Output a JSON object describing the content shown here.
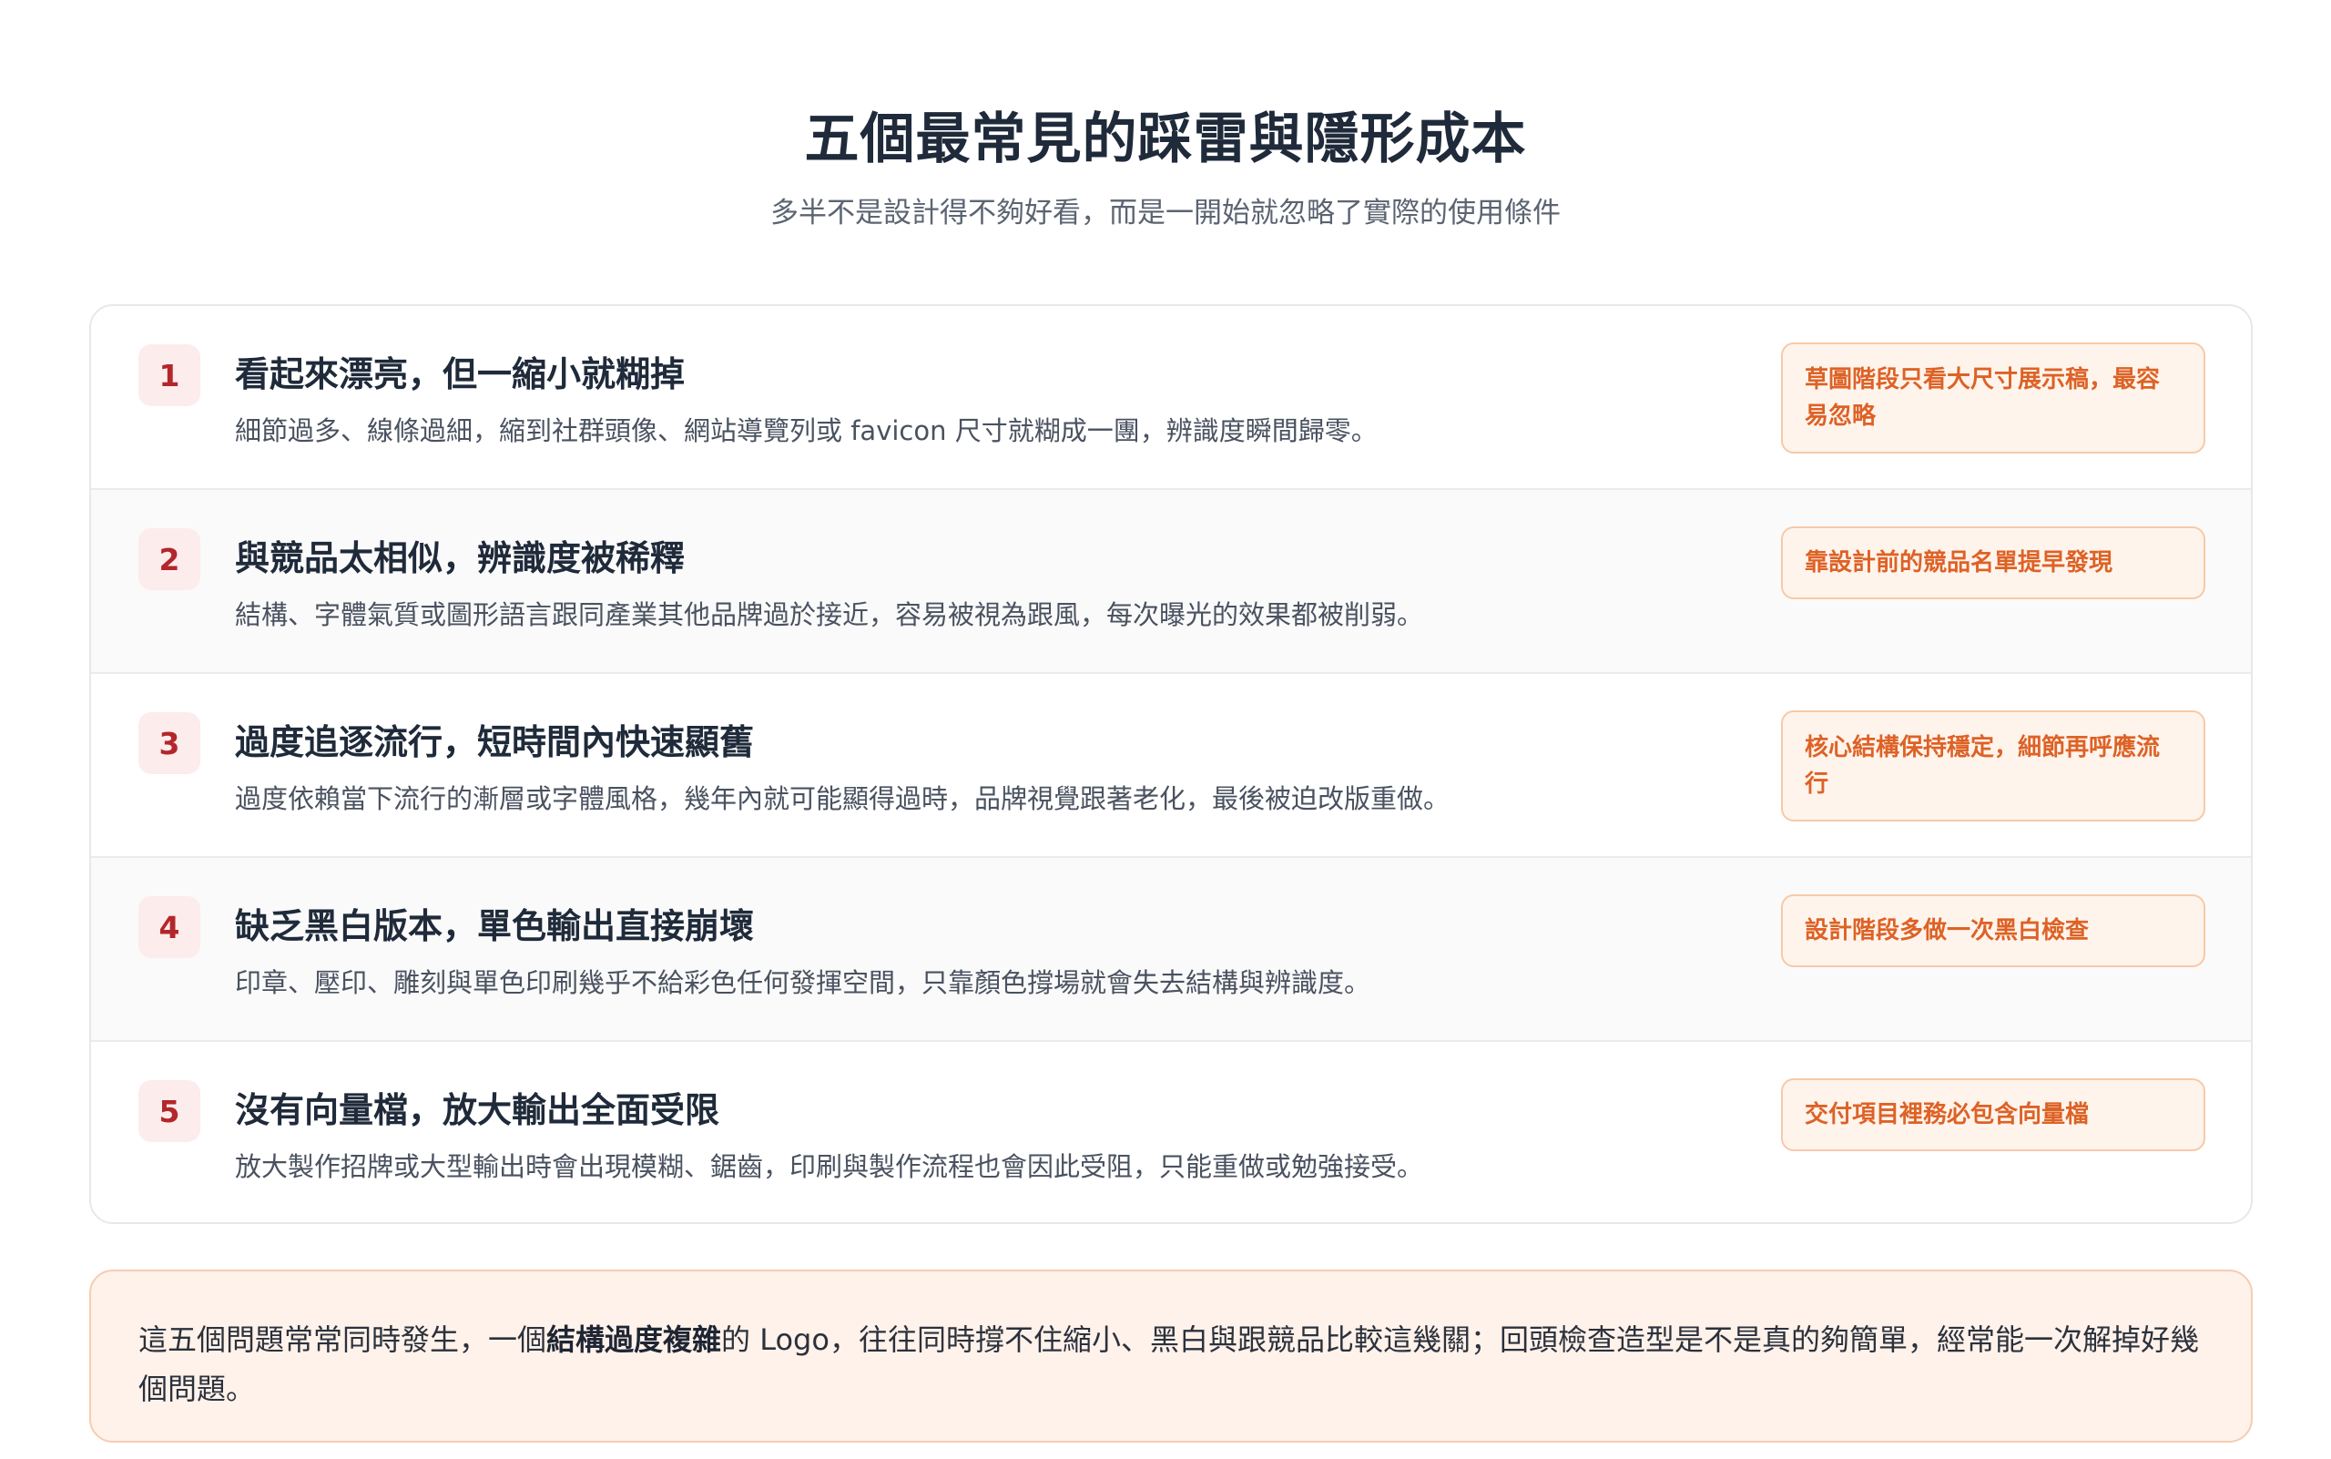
{
  "header": {
    "title": "五個最常見的踩雷與隱形成本",
    "subtitle": "多半不是設計得不夠好看，而是一開始就忽略了實際的使用條件"
  },
  "items": [
    {
      "number": "1",
      "title": "看起來漂亮，但一縮小就糊掉",
      "description": "細節過多、線條過細，縮到社群頭像、網站導覽列或 favicon 尺寸就糊成一團，辨識度瞬間歸零。",
      "tag": "草圖階段只看大尺寸展示稿，最容易忽略"
    },
    {
      "number": "2",
      "title": "與競品太相似，辨識度被稀釋",
      "description": "結構、字體氣質或圖形語言跟同產業其他品牌過於接近，容易被視為跟風，每次曝光的效果都被削弱。",
      "tag": "靠設計前的競品名單提早發現"
    },
    {
      "number": "3",
      "title": "過度追逐流行，短時間內快速顯舊",
      "description": "過度依賴當下流行的漸層或字體風格，幾年內就可能顯得過時，品牌視覺跟著老化，最後被迫改版重做。",
      "tag": "核心結構保持穩定，細節再呼應流行"
    },
    {
      "number": "4",
      "title": "缺乏黑白版本，單色輸出直接崩壞",
      "description": "印章、壓印、雕刻與單色印刷幾乎不給彩色任何發揮空間，只靠顏色撐場就會失去結構與辨識度。",
      "tag": "設計階段多做一次黑白檢查"
    },
    {
      "number": "5",
      "title": "沒有向量檔，放大輸出全面受限",
      "description": "放大製作招牌或大型輸出時會出現模糊、鋸齒，印刷與製作流程也會因此受阻，只能重做或勉強接受。",
      "tag": "交付項目裡務必包含向量檔"
    }
  ],
  "note": {
    "before": "這五個問題常常同時發生，一個",
    "emphasis": "結構過度複雜",
    "after": "的 Logo，往往同時撐不住縮小、黑白與跟競品比較這幾關；回頭檢查造型是不是真的夠簡單，經常能一次解掉好幾個問題。"
  },
  "colors": {
    "accent_red": "#b3262b",
    "tag_orange": "#dd6226",
    "note_bg": "#fff2ea"
  }
}
